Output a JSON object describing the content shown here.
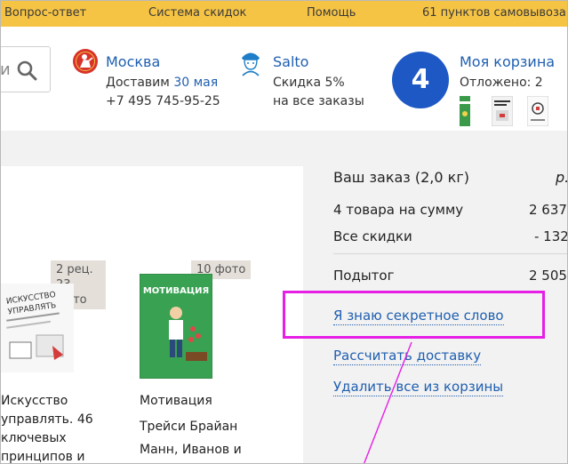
{
  "topbar": {
    "links": [
      "Вопрос-ответ",
      "Система скидок",
      "Помощь",
      "61 пунктов самовывоза"
    ]
  },
  "search": {
    "stub_text": "и"
  },
  "location": {
    "city": "Москва",
    "delivery_prefix": "Доставим",
    "delivery_date": "30 мая",
    "phone": "+7 495 745-95-25"
  },
  "salto": {
    "title": "Salto",
    "discount_line1": "Скидка 5%",
    "discount_line2": "на все заказы"
  },
  "cart": {
    "count": "4",
    "title": "Моя корзина",
    "deferred": "Отложено: 2"
  },
  "products": [
    {
      "badge_line1": "2 рец.",
      "badge_line2": "23 фото",
      "cover_title": "ИСКУССТВО УПРАВЛЯТЬ",
      "title_lines": [
        "Искусство",
        "управлять. 46",
        "ключевых",
        "принципов и"
      ]
    },
    {
      "badge": "10 фото",
      "cover_title": "МОТИВАЦИЯ",
      "title": "Мотивация",
      "author_lines": [
        "Трейси Брайан",
        "Манн, Иванов и"
      ]
    }
  ],
  "summary": {
    "order_label": "Ваш заказ (2,0 кг)",
    "order_currency": "р.",
    "items_label": "4 товара на сумму",
    "items_value": "2 637",
    "discount_label": "Все скидки",
    "discount_value": "- 132",
    "subtotal_label": "Подытог",
    "subtotal_value": "2 505",
    "secret_word_link": "Я знаю секретное слово",
    "delivery_link": "Рассчитать доставку",
    "clear_link": "Удалить все из корзины"
  },
  "colors": {
    "topbar": "#f6c444",
    "link": "#1f5fb0",
    "cart_circle": "#1e58c4",
    "highlight": "#e61ee6"
  }
}
